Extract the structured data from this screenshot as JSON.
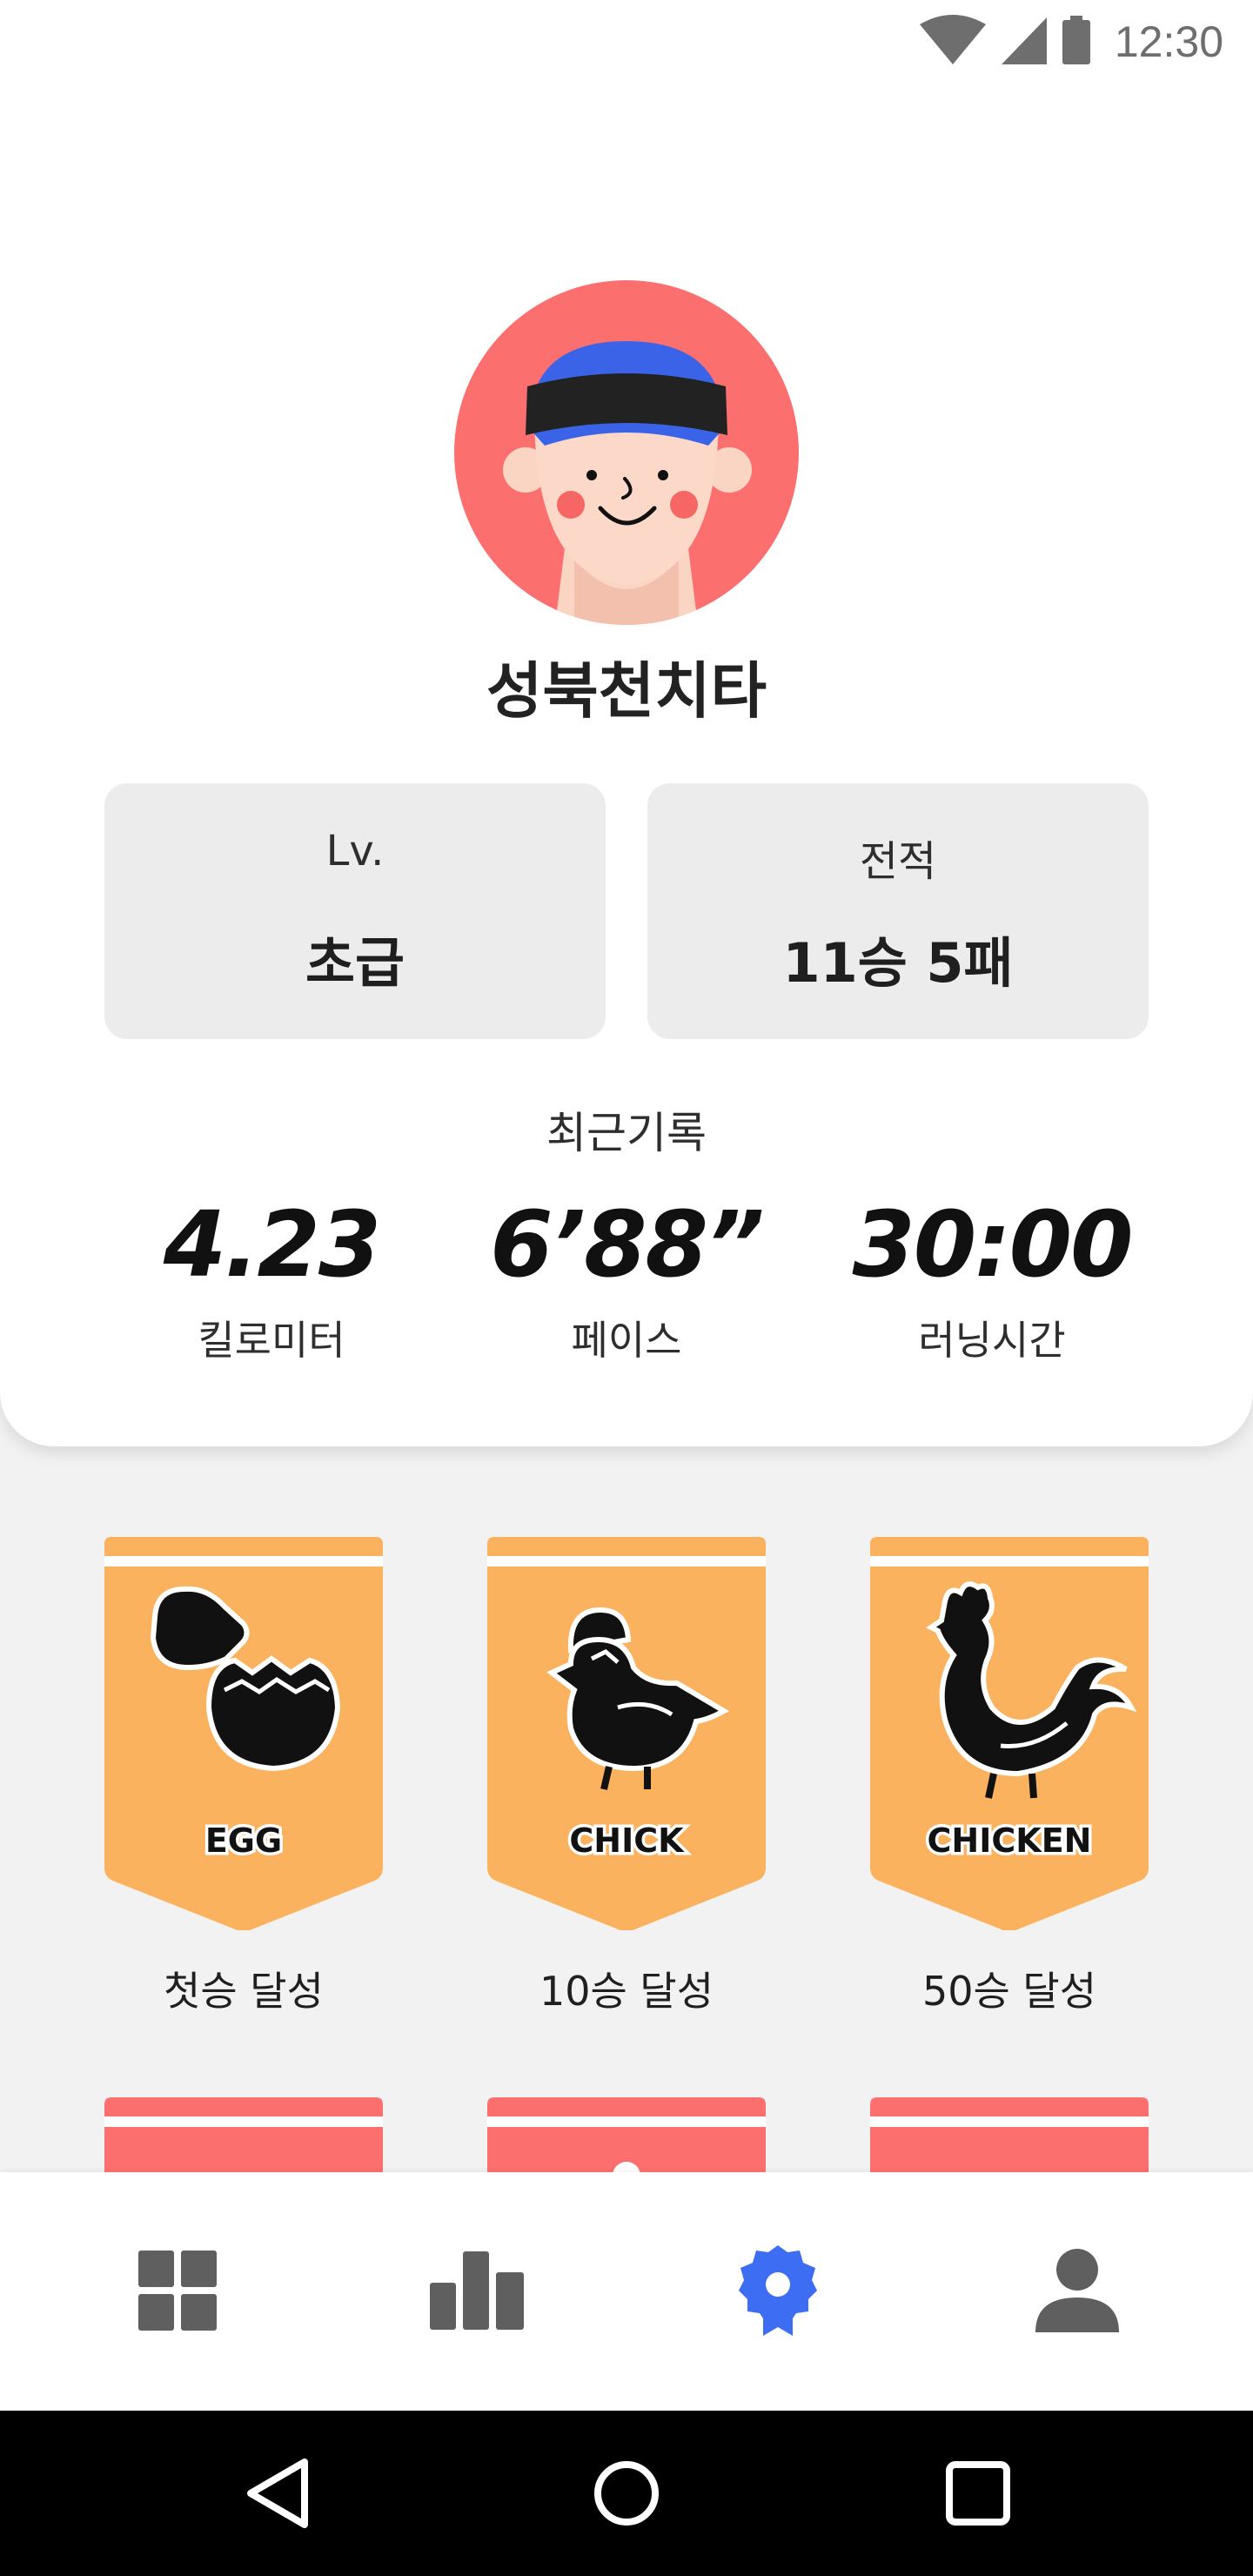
{
  "status_bar": {
    "time": "12:30",
    "icons": [
      "wifi-icon",
      "signal-icon",
      "battery-icon"
    ]
  },
  "profile": {
    "nickname": "성북천치타",
    "avatar": "avatar-illustration"
  },
  "stats": {
    "level_label": "Lv.",
    "level_value": "초급",
    "record_label": "전적",
    "record_value": "11승 5패"
  },
  "recent": {
    "title": "최근기록",
    "items": [
      {
        "value": "4.23",
        "label": "킬로미터"
      },
      {
        "value": "6’88”",
        "label": "페이스"
      },
      {
        "value": "30:00",
        "label": "러닝시간"
      }
    ]
  },
  "badges": [
    {
      "name": "EGG",
      "caption": "첫승 달성",
      "color": "#fbb25e"
    },
    {
      "name": "CHICK",
      "caption": "10승 달성",
      "color": "#fbb25e"
    },
    {
      "name": "CHICKEN",
      "caption": "50승 달성",
      "color": "#fbb25e"
    },
    {
      "name": "",
      "caption": "",
      "color": "#fb6f6f"
    },
    {
      "name": "",
      "caption": "",
      "color": "#fb6f6f"
    },
    {
      "name": "",
      "caption": "",
      "color": "#fb6f6f"
    }
  ],
  "bottom_nav": {
    "items": [
      {
        "icon": "grid-icon",
        "active": false
      },
      {
        "icon": "bar-chart-icon",
        "active": false
      },
      {
        "icon": "badge-icon",
        "active": true
      },
      {
        "icon": "person-icon",
        "active": false
      }
    ],
    "active_color": "#3d6df2",
    "inactive_color": "#5f5f5f"
  },
  "system_nav": [
    "back-icon",
    "home-icon",
    "recents-icon"
  ]
}
